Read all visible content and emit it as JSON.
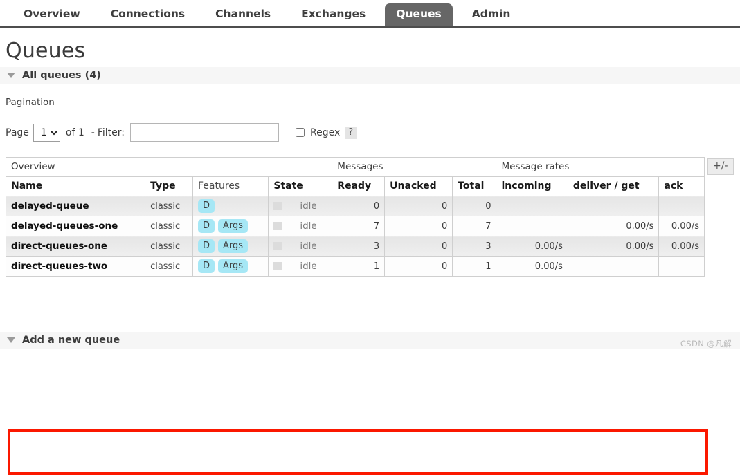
{
  "nav": {
    "items": [
      {
        "label": "Overview",
        "active": false
      },
      {
        "label": "Connections",
        "active": false
      },
      {
        "label": "Channels",
        "active": false
      },
      {
        "label": "Exchanges",
        "active": false
      },
      {
        "label": "Queues",
        "active": true
      },
      {
        "label": "Admin",
        "active": false
      }
    ]
  },
  "page": {
    "title": "Queues",
    "all_queues_heading": "All queues (4)",
    "pagination_heading": "Pagination",
    "add_queue_heading": "Add a new queue"
  },
  "pagination": {
    "page_label": "Page",
    "page_value": "1",
    "page_options": [
      "1"
    ],
    "of_label": "of 1",
    "dash": "-",
    "filter_label": "Filter:",
    "filter_value": "",
    "filter_placeholder": "",
    "regex_label": "Regex",
    "regex_checked": false,
    "help_label": "?"
  },
  "table": {
    "toggle_columns_label": "+/-",
    "groups": [
      {
        "label": "Overview",
        "span": 4
      },
      {
        "label": "Messages",
        "span": 3
      },
      {
        "label": "Message rates",
        "span": 3
      }
    ],
    "columns": [
      {
        "label": "Name",
        "bold": true
      },
      {
        "label": "Type",
        "bold": true
      },
      {
        "label": "Features",
        "bold": false
      },
      {
        "label": "State",
        "bold": true
      },
      {
        "label": "Ready",
        "bold": true
      },
      {
        "label": "Unacked",
        "bold": true
      },
      {
        "label": "Total",
        "bold": true
      },
      {
        "label": "incoming",
        "bold": true
      },
      {
        "label": "deliver / get",
        "bold": true
      },
      {
        "label": "ack",
        "bold": true
      }
    ],
    "rows": [
      {
        "name": "delayed-queue",
        "type": "classic",
        "features": [
          "D"
        ],
        "state": "idle",
        "ready": "0",
        "unacked": "0",
        "total": "0",
        "incoming": "",
        "deliver_get": "",
        "ack": ""
      },
      {
        "name": "delayed-queues-one",
        "type": "classic",
        "features": [
          "D",
          "Args"
        ],
        "state": "idle",
        "ready": "7",
        "unacked": "0",
        "total": "7",
        "incoming": "",
        "deliver_get": "0.00/s",
        "ack": "0.00/s"
      },
      {
        "name": "direct-queues-one",
        "type": "classic",
        "features": [
          "D",
          "Args"
        ],
        "state": "idle",
        "ready": "3",
        "unacked": "0",
        "total": "3",
        "incoming": "0.00/s",
        "deliver_get": "0.00/s",
        "ack": "0.00/s"
      },
      {
        "name": "direct-queues-two",
        "type": "classic",
        "features": [
          "D",
          "Args"
        ],
        "state": "idle",
        "ready": "1",
        "unacked": "0",
        "total": "1",
        "incoming": "0.00/s",
        "deliver_get": "",
        "ack": ""
      }
    ]
  },
  "annotation": {
    "color": "#fb1800"
  },
  "watermark": {
    "text": "CSDN @凡解"
  }
}
